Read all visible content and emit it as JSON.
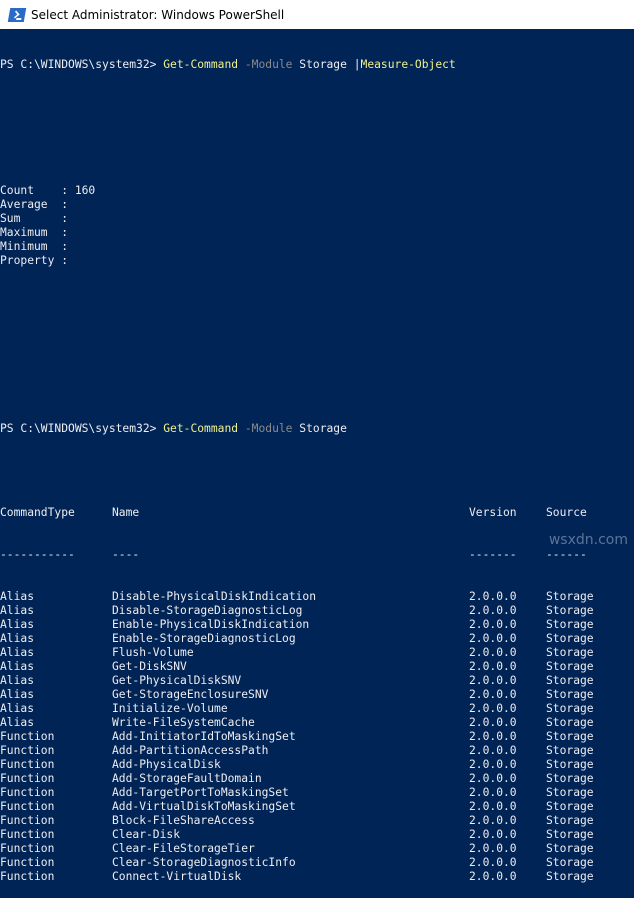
{
  "window": {
    "title": "Select Administrator: Windows PowerShell",
    "icon": "powershell-icon"
  },
  "console": {
    "prompt1": {
      "prompt": "PS C:\\WINDOWS\\system32> ",
      "command": "Get-Command",
      "param": " -Module",
      "arg": " Storage ",
      "pipe": "|",
      "pipe_command": "Measure-Object"
    },
    "measure": [
      {
        "label": "Count    ",
        "sep": ": ",
        "value": "160"
      },
      {
        "label": "Average  ",
        "sep": ": ",
        "value": ""
      },
      {
        "label": "Sum      ",
        "sep": ": ",
        "value": ""
      },
      {
        "label": "Maximum  ",
        "sep": ": ",
        "value": ""
      },
      {
        "label": "Minimum  ",
        "sep": ": ",
        "value": ""
      },
      {
        "label": "Property ",
        "sep": ": ",
        "value": ""
      }
    ],
    "prompt2": {
      "prompt": "PS C:\\WINDOWS\\system32> ",
      "command": "Get-Command",
      "param": " -Module",
      "arg": " Storage"
    },
    "table": {
      "headers": [
        "CommandType",
        "Name",
        "Version",
        "Source"
      ],
      "underlines": [
        "-----------",
        "----",
        "-------",
        "------"
      ],
      "rows": [
        [
          "Alias",
          "Disable-PhysicalDiskIndication",
          "2.0.0.0",
          "Storage"
        ],
        [
          "Alias",
          "Disable-StorageDiagnosticLog",
          "2.0.0.0",
          "Storage"
        ],
        [
          "Alias",
          "Enable-PhysicalDiskIndication",
          "2.0.0.0",
          "Storage"
        ],
        [
          "Alias",
          "Enable-StorageDiagnosticLog",
          "2.0.0.0",
          "Storage"
        ],
        [
          "Alias",
          "Flush-Volume",
          "2.0.0.0",
          "Storage"
        ],
        [
          "Alias",
          "Get-DiskSNV",
          "2.0.0.0",
          "Storage"
        ],
        [
          "Alias",
          "Get-PhysicalDiskSNV",
          "2.0.0.0",
          "Storage"
        ],
        [
          "Alias",
          "Get-StorageEnclosureSNV",
          "2.0.0.0",
          "Storage"
        ],
        [
          "Alias",
          "Initialize-Volume",
          "2.0.0.0",
          "Storage"
        ],
        [
          "Alias",
          "Write-FileSystemCache",
          "2.0.0.0",
          "Storage"
        ],
        [
          "Function",
          "Add-InitiatorIdToMaskingSet",
          "2.0.0.0",
          "Storage"
        ],
        [
          "Function",
          "Add-PartitionAccessPath",
          "2.0.0.0",
          "Storage"
        ],
        [
          "Function",
          "Add-PhysicalDisk",
          "2.0.0.0",
          "Storage"
        ],
        [
          "Function",
          "Add-StorageFaultDomain",
          "2.0.0.0",
          "Storage"
        ],
        [
          "Function",
          "Add-TargetPortToMaskingSet",
          "2.0.0.0",
          "Storage"
        ],
        [
          "Function",
          "Add-VirtualDiskToMaskingSet",
          "2.0.0.0",
          "Storage"
        ],
        [
          "Function",
          "Block-FileShareAccess",
          "2.0.0.0",
          "Storage"
        ],
        [
          "Function",
          "Clear-Disk",
          "2.0.0.0",
          "Storage"
        ],
        [
          "Function",
          "Clear-FileStorageTier",
          "2.0.0.0",
          "Storage"
        ],
        [
          "Function",
          "Clear-StorageDiagnosticInfo",
          "2.0.0.0",
          "Storage"
        ],
        [
          "Function",
          "Connect-VirtualDisk",
          "2.0.0.0",
          "Storage"
        ]
      ]
    }
  },
  "watermark": "wsxdn.com"
}
